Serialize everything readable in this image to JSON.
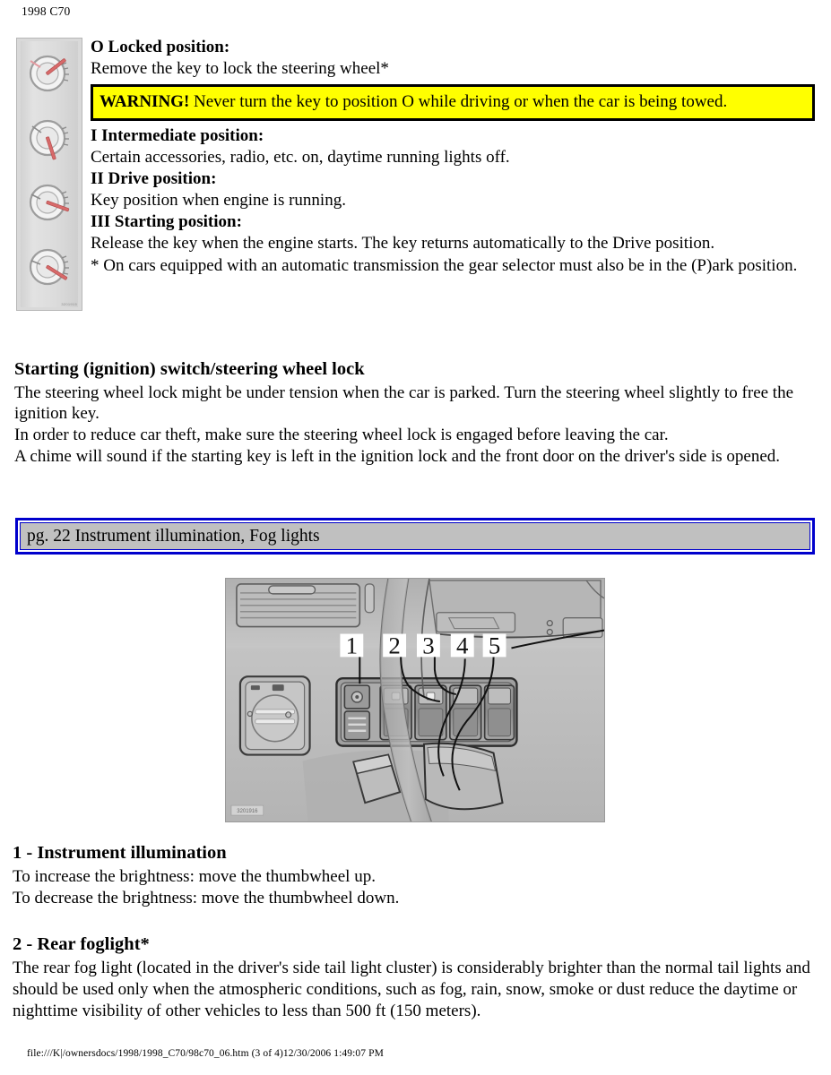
{
  "header": {
    "running_title": "1998 C70"
  },
  "ignition_figure": {
    "caption_code": "3201915",
    "positions": [
      {
        "name": "locked",
        "key_angle": -38
      },
      {
        "name": "intermediate",
        "key_angle": -72
      },
      {
        "name": "drive",
        "key_angle": 22
      },
      {
        "name": "starting",
        "key_angle": 48
      }
    ]
  },
  "key_positions": {
    "locked": {
      "heading": "O Locked position:",
      "text": "Remove the key to lock the steering wheel*"
    },
    "intermediate": {
      "heading": "I Intermediate position:",
      "text": "Certain accessories, radio, etc. on, daytime running lights off."
    },
    "drive": {
      "heading": "II Drive position:",
      "text": "Key position when engine is running."
    },
    "starting": {
      "heading": "III Starting position:",
      "text": "Release the key when the engine starts. The key returns automatically to the Drive position."
    },
    "footnote": "* On cars equipped with an automatic transmission the gear selector must also be in the (P)ark position."
  },
  "warning": {
    "label": "WARNING!",
    "text": " Never turn the key to position O while driving or when the car is being towed.",
    "background_color": "#ffff00",
    "border_color": "#000000"
  },
  "ignition_switch_section": {
    "heading": "Starting (ignition) switch/steering wheel lock",
    "paragraph_1": "The steering wheel lock might be under tension when the car is parked. Turn the steering wheel slightly to free the ignition key.",
    "paragraph_2": "In order to reduce car theft, make sure the steering wheel lock is engaged before leaving the car.",
    "paragraph_3": "A chime will sound if the starting key is left in the ignition lock and the front door on the driver's side is opened."
  },
  "section_bar": {
    "label": "pg. 22 Instrument illumination, Fog lights",
    "border_color": "#0000cc",
    "fill_color": "#c0c0c0"
  },
  "dashboard_photo": {
    "alt": "Dashboard switch panel with steering wheel",
    "callouts": [
      "1",
      "2",
      "3",
      "4",
      "5"
    ],
    "watermark": "3201916"
  },
  "items": [
    {
      "heading": "1 - Instrument illumination",
      "lines": [
        "To increase the brightness: move the thumbwheel up.",
        "To decrease the brightness: move the thumbwheel down."
      ]
    },
    {
      "heading": "2 - Rear foglight*",
      "lines": [
        "The rear fog light (located in the driver's side tail light cluster) is considerably brighter than the normal tail lights and should be used only when the atmospheric conditions, such as fog, rain, snow, smoke or dust reduce the daytime or nighttime visibility of other vehicles to less than 500 ft (150 meters)."
      ]
    }
  ],
  "footer": {
    "path": "file:///K|/ownersdocs/1998/1998_C70/98c70_06.htm (3 of 4)12/30/2006 1:49:07 PM"
  }
}
